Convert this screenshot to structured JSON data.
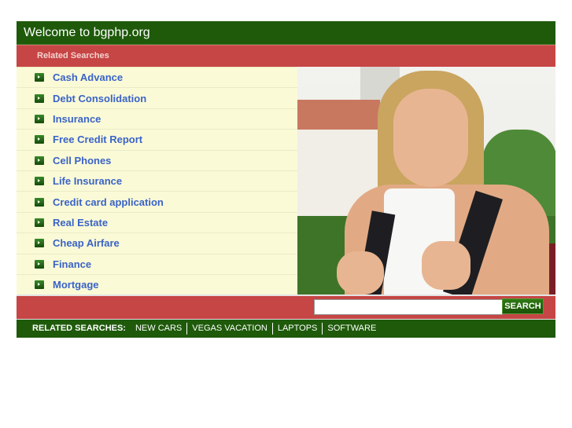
{
  "header": {
    "title": "Welcome to bgphp.org"
  },
  "related_bar": {
    "label": "Related Searches"
  },
  "list": {
    "items": [
      {
        "label": "Cash Advance",
        "icon": "arrow-right-icon"
      },
      {
        "label": "Debt Consolidation",
        "icon": "arrow-right-icon"
      },
      {
        "label": "Insurance",
        "icon": "arrow-right-icon"
      },
      {
        "label": "Free Credit Report",
        "icon": "arrow-right-icon"
      },
      {
        "label": "Cell Phones",
        "icon": "arrow-right-icon"
      },
      {
        "label": "Life Insurance",
        "icon": "arrow-right-icon"
      },
      {
        "label": "Credit card application",
        "icon": "arrow-right-icon"
      },
      {
        "label": "Real Estate",
        "icon": "arrow-right-icon"
      },
      {
        "label": "Cheap Airfare",
        "icon": "arrow-right-icon"
      },
      {
        "label": "Finance",
        "icon": "arrow-right-icon"
      },
      {
        "label": "Mortgage",
        "icon": "arrow-right-icon"
      }
    ]
  },
  "photo": {
    "description": "smiling student with backpack"
  },
  "search": {
    "value": "",
    "placeholder": "",
    "button_label": "SEARCH"
  },
  "footer": {
    "label": "RELATED SEARCHES:",
    "links": [
      "NEW CARS",
      "VEGAS VACATION",
      "LAPTOPS",
      "SOFTWARE"
    ]
  },
  "colors": {
    "green": "#1e5a0a",
    "red": "#c64545",
    "list_bg": "#fafad7",
    "link": "#3a63c8"
  }
}
